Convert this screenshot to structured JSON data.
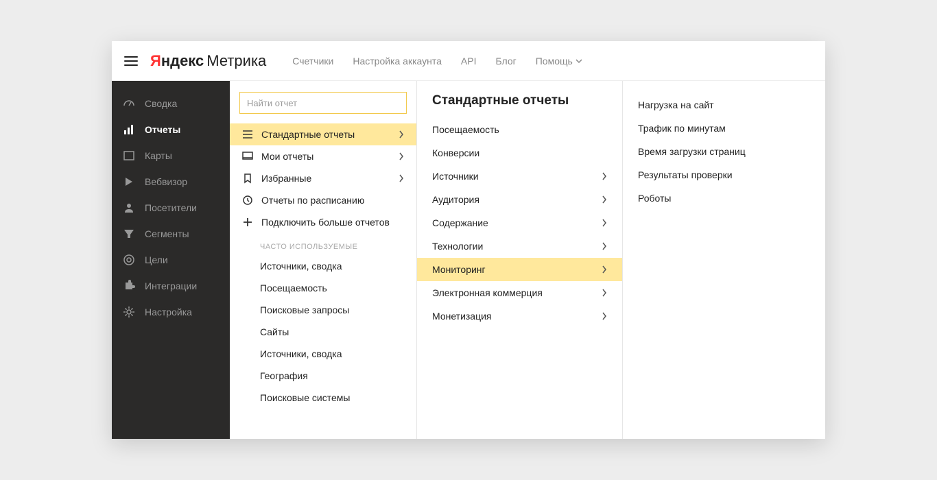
{
  "brand": {
    "ya": "Я",
    "ndex": "ндекс",
    "product": "Метрика"
  },
  "topnav": {
    "counters": "Счетчики",
    "account": "Настройка аккаунта",
    "api": "API",
    "blog": "Блог",
    "help": "Помощь"
  },
  "sidebar": {
    "summary": "Сводка",
    "reports": "Отчеты",
    "maps": "Карты",
    "webvisor": "Вебвизор",
    "visitors": "Посетители",
    "segments": "Сегменты",
    "goals": "Цели",
    "integrations": "Интеграции",
    "settings": "Настройка"
  },
  "reports_panel": {
    "search_placeholder": "Найти отчет",
    "standard": "Стандартные отчеты",
    "my": "Мои отчеты",
    "favorites": "Избранные",
    "scheduled": "Отчеты по расписанию",
    "add_more": "Подключить больше отчетов",
    "freq_head": "ЧАСТО ИСПОЛЬЗУЕМЫЕ",
    "freq": [
      "Источники, сводка",
      "Посещаемость",
      "Поисковые запросы",
      "Сайты",
      "Источники, сводка",
      "География",
      "Поисковые системы"
    ]
  },
  "categories": {
    "title": "Стандартные отчеты",
    "items": [
      {
        "label": "Посещаемость",
        "hasChildren": false
      },
      {
        "label": "Конверсии",
        "hasChildren": false
      },
      {
        "label": "Источники",
        "hasChildren": true
      },
      {
        "label": "Аудитория",
        "hasChildren": true
      },
      {
        "label": "Содержание",
        "hasChildren": true
      },
      {
        "label": "Технологии",
        "hasChildren": true
      },
      {
        "label": "Мониторинг",
        "hasChildren": true,
        "highlighted": true
      },
      {
        "label": "Электронная коммерция",
        "hasChildren": true
      },
      {
        "label": "Монетизация",
        "hasChildren": true
      }
    ]
  },
  "details": [
    "Нагрузка на сайт",
    "Трафик по минутам",
    "Время загрузки страниц",
    "Результаты проверки",
    "Роботы"
  ]
}
